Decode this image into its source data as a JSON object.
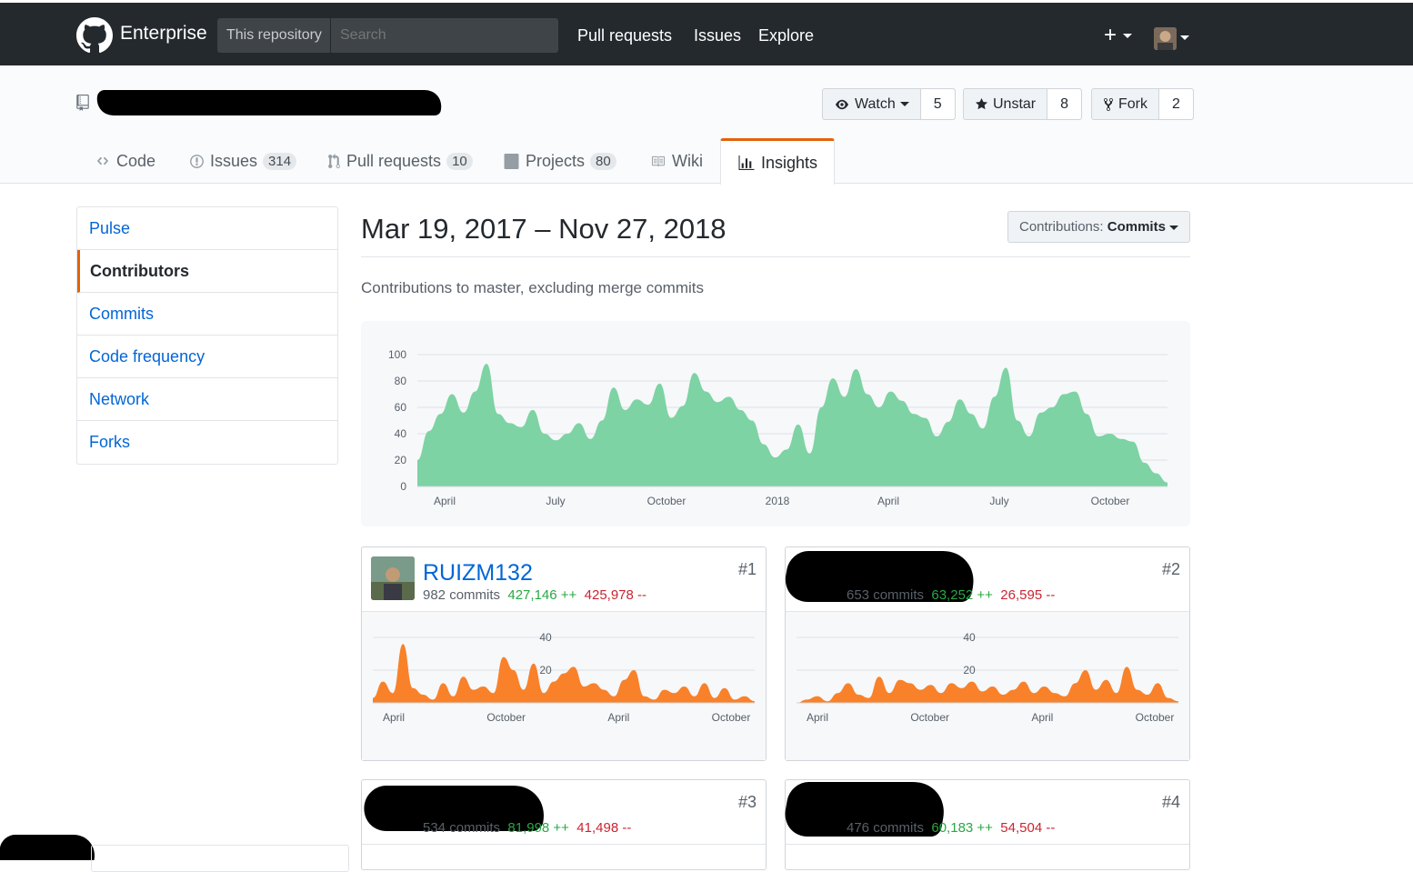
{
  "header": {
    "brand": "Enterprise",
    "scope_label": "This repository",
    "search_placeholder": "Search",
    "nav": [
      "Pull requests",
      "Issues",
      "Explore"
    ],
    "plus": "+"
  },
  "repo": {
    "watch_label": "Watch",
    "watch_count": "5",
    "star_label": "Unstar",
    "star_count": "8",
    "fork_label": "Fork",
    "fork_count": "2"
  },
  "tabs": {
    "code": "Code",
    "issues": "Issues",
    "issues_count": "314",
    "pulls": "Pull requests",
    "pulls_count": "10",
    "projects": "Projects",
    "projects_count": "80",
    "wiki": "Wiki",
    "insights": "Insights"
  },
  "sidebar": {
    "items": [
      "Pulse",
      "Contributors",
      "Commits",
      "Code frequency",
      "Network",
      "Forks"
    ],
    "selected": "Contributors"
  },
  "main": {
    "date_range": "Mar 19, 2017 – Nov 27, 2018",
    "contributions_prefix": "Contributions:",
    "contributions_value": "Commits",
    "subtitle": "Contributions to master, excluding merge commits"
  },
  "chart_data": [
    {
      "type": "area",
      "color": "#7dd3a3",
      "ylim": [
        0,
        100
      ],
      "yticks": [
        "0",
        "20",
        "40",
        "60",
        "80",
        "100"
      ],
      "xticks": [
        "April",
        "July",
        "October",
        "2018",
        "April",
        "July",
        "October"
      ],
      "values": [
        20,
        42,
        55,
        70,
        56,
        72,
        93,
        55,
        48,
        45,
        58,
        40,
        35,
        40,
        48,
        36,
        50,
        75,
        58,
        66,
        62,
        78,
        52,
        61,
        86,
        72,
        64,
        68,
        58,
        50,
        32,
        22,
        28,
        47,
        25,
        60,
        82,
        68,
        89,
        70,
        60,
        72,
        65,
        55,
        52,
        38,
        49,
        66,
        55,
        44,
        68,
        90,
        50,
        38,
        56,
        60,
        70,
        72,
        55,
        38,
        40,
        36,
        34,
        18,
        10,
        3
      ]
    },
    {
      "type": "area",
      "color": "#f9812a",
      "ylim": [
        0,
        40
      ],
      "yticks": [
        "20",
        "40"
      ],
      "xticks": [
        "April",
        "October",
        "April",
        "October"
      ],
      "values": [
        3,
        13,
        6,
        36,
        9,
        5,
        2,
        12,
        4,
        16,
        8,
        10,
        6,
        28,
        20,
        8,
        24,
        6,
        13,
        18,
        22,
        10,
        12,
        8,
        4,
        14,
        20,
        4,
        2,
        8,
        6,
        10,
        4,
        12,
        3,
        9,
        2,
        4,
        1
      ]
    },
    {
      "type": "area",
      "color": "#f9812a",
      "ylim": [
        0,
        40
      ],
      "yticks": [
        "20",
        "40"
      ],
      "xticks": [
        "April",
        "October",
        "April",
        "October"
      ],
      "values": [
        0,
        2,
        4,
        1,
        6,
        12,
        5,
        3,
        16,
        6,
        14,
        12,
        8,
        11,
        6,
        12,
        9,
        13,
        7,
        10,
        5,
        8,
        13,
        6,
        10,
        6,
        4,
        12,
        20,
        8,
        14,
        6,
        22,
        8,
        5,
        12,
        3,
        1
      ]
    }
  ],
  "contributors": [
    {
      "name": "RUIZM132",
      "commits": "982 commits",
      "adds": "427,146 ++",
      "dels": "425,978 --",
      "rank": "#1"
    },
    {
      "name": "",
      "commits": "653 commits",
      "adds": "63,252 ++",
      "dels": "26,595 --",
      "rank": "#2"
    },
    {
      "name": "",
      "commits": "534 commits",
      "adds": "81,998 ++",
      "dels": "41,498 --",
      "rank": "#3"
    },
    {
      "name": "",
      "commits": "476 commits",
      "adds": "60,183 ++",
      "dels": "54,504 --",
      "rank": "#4"
    }
  ],
  "icons": [
    "github-logo-icon",
    "repo-icon",
    "eye-icon",
    "star-icon",
    "fork-icon",
    "code-icon",
    "issue-icon",
    "pr-icon",
    "project-icon",
    "wiki-icon",
    "graph-icon"
  ]
}
